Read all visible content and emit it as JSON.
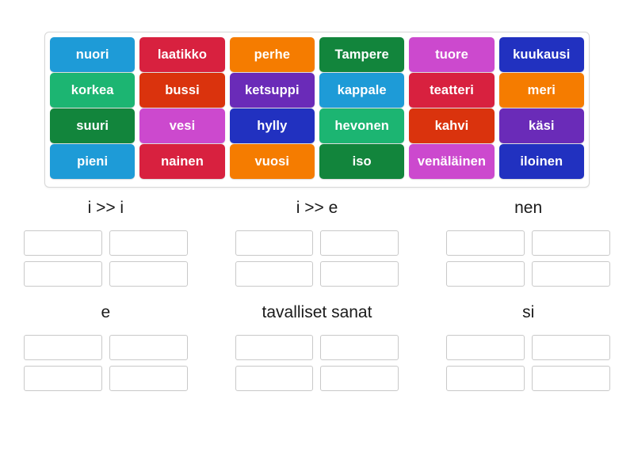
{
  "word_bank": {
    "name": "word-bank",
    "rows": [
      [
        {
          "label": "nuori",
          "color": "#1e9bd7"
        },
        {
          "label": "laatikko",
          "color": "#d8213f"
        },
        {
          "label": "perhe",
          "color": "#f57c00"
        },
        {
          "label": "Tampere",
          "color": "#12853c"
        },
        {
          "label": "tuore",
          "color": "#cc49ce"
        },
        {
          "label": "kuukausi",
          "color": "#2131c0"
        }
      ],
      [
        {
          "label": "korkea",
          "color": "#1cb572"
        },
        {
          "label": "bussi",
          "color": "#da330d"
        },
        {
          "label": "ketsuppi",
          "color": "#6a2bb8"
        },
        {
          "label": "kappale",
          "color": "#1e9bd7"
        },
        {
          "label": "teatteri",
          "color": "#d8213f"
        },
        {
          "label": "meri",
          "color": "#f57c00"
        }
      ],
      [
        {
          "label": "suuri",
          "color": "#12853c"
        },
        {
          "label": "vesi",
          "color": "#cc49ce"
        },
        {
          "label": "hylly",
          "color": "#2131c0"
        },
        {
          "label": "hevonen",
          "color": "#1cb572"
        },
        {
          "label": "kahvi",
          "color": "#da330d"
        },
        {
          "label": "käsi",
          "color": "#6a2bb8"
        }
      ],
      [
        {
          "label": "pieni",
          "color": "#1e9bd7"
        },
        {
          "label": "nainen",
          "color": "#d8213f"
        },
        {
          "label": "vuosi",
          "color": "#f57c00"
        },
        {
          "label": "iso",
          "color": "#12853c"
        },
        {
          "label": "venäläinen",
          "color": "#cc49ce"
        },
        {
          "label": "iloinen",
          "color": "#2131c0"
        }
      ]
    ]
  },
  "categories": [
    {
      "title": "i >> i",
      "slots": [
        "",
        "",
        "",
        ""
      ]
    },
    {
      "title": "i >> e",
      "slots": [
        "",
        "",
        "",
        ""
      ]
    },
    {
      "title": "nen",
      "slots": [
        "",
        "",
        "",
        ""
      ]
    },
    {
      "title": "e",
      "slots": [
        "",
        "",
        "",
        ""
      ]
    },
    {
      "title": "tavalliset sanat",
      "slots": [
        "",
        "",
        "",
        ""
      ]
    },
    {
      "title": "si",
      "slots": [
        "",
        "",
        "",
        ""
      ]
    }
  ],
  "colors": {
    "tile_blue": "#1e9bd7",
    "tile_crimson": "#d8213f",
    "tile_orange": "#f57c00",
    "tile_dark_green": "#12853c",
    "tile_orchid": "#cc49ce",
    "tile_navy": "#2131c0",
    "tile_emerald": "#1cb572",
    "tile_orange_red": "#da330d",
    "tile_purple": "#6a2bb8",
    "slot_border": "#c9c9c9",
    "bank_border": "#d7d7d7",
    "page_background": "#ffffff",
    "title_text": "#1a1a1a",
    "tile_text": "#ffffff"
  }
}
